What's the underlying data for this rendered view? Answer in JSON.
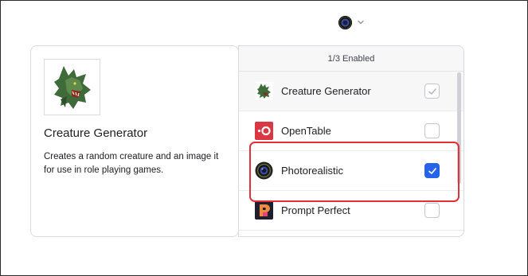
{
  "selector": {
    "current_plugin_icon": "photorealistic-lens-icon",
    "chevron": "chevron-down-icon"
  },
  "detail": {
    "title": "Creature Generator",
    "description": "Creates a random creature and an image it for use in role playing games."
  },
  "list": {
    "header": "1/3 Enabled",
    "items": [
      {
        "label": "Creature Generator",
        "icon": "werewolf-icon",
        "checked": true,
        "selected": true
      },
      {
        "label": "OpenTable",
        "icon": "opentable-icon",
        "checked": false,
        "selected": false
      },
      {
        "label": "Photorealistic",
        "icon": "camera-lens-icon",
        "checked": true,
        "selected": false
      },
      {
        "label": "Prompt Perfect",
        "icon": "prompt-perfect-icon",
        "checked": false,
        "selected": false
      }
    ]
  },
  "colors": {
    "accent": "#2563eb",
    "highlight": "#e0303a",
    "opentable": "#da3743"
  }
}
